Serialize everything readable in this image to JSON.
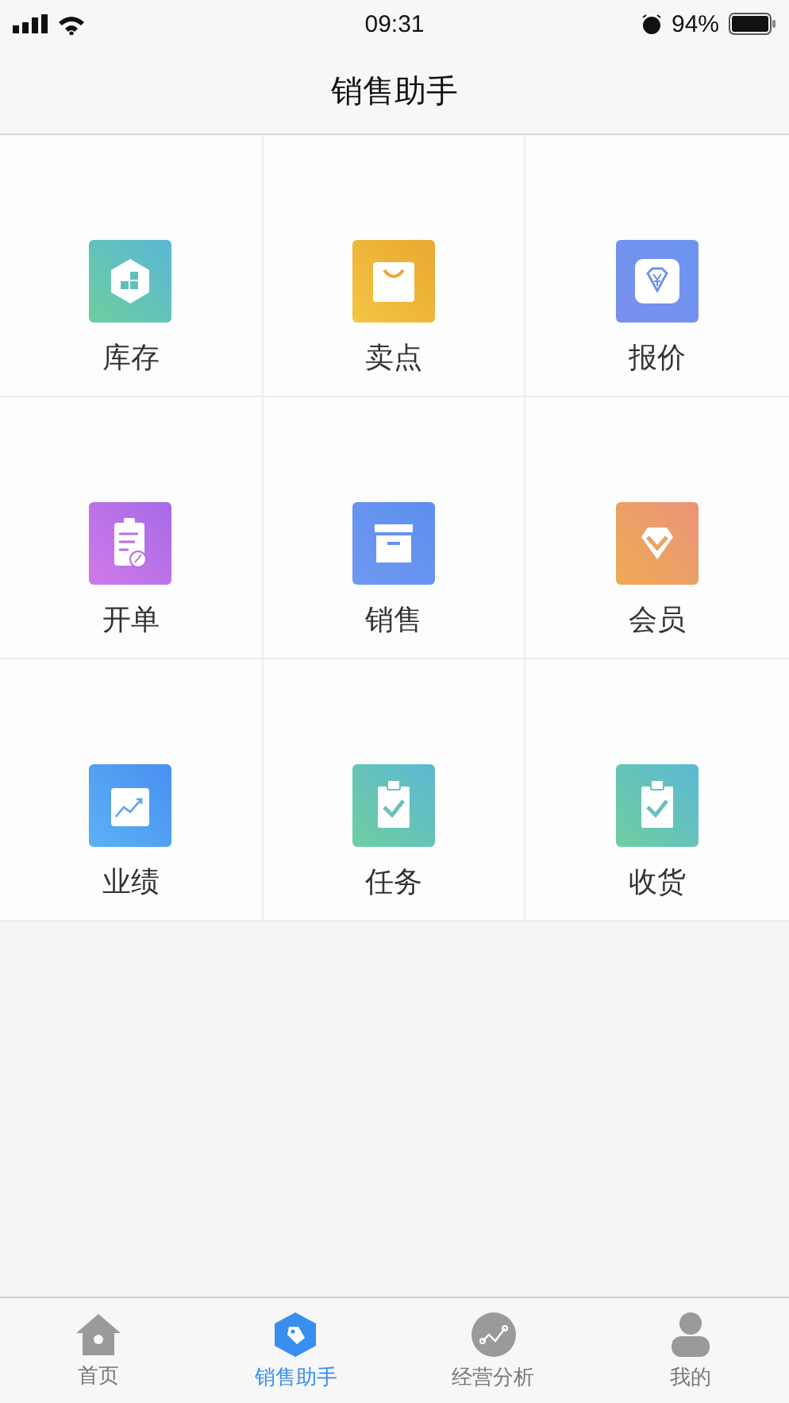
{
  "status_bar": {
    "time": "09:31",
    "battery": "94%"
  },
  "nav_bar": {
    "title": "销售助手"
  },
  "tiles": [
    {
      "label": "库存",
      "kind": "stock"
    },
    {
      "label": "卖点",
      "kind": "bag"
    },
    {
      "label": "报价",
      "kind": "quote"
    },
    {
      "label": "开单",
      "kind": "order"
    },
    {
      "label": "销售",
      "kind": "archive"
    },
    {
      "label": "会员",
      "kind": "member"
    },
    {
      "label": "业绩",
      "kind": "chart"
    },
    {
      "label": "任务",
      "kind": "check"
    },
    {
      "label": "收货",
      "kind": "check"
    }
  ],
  "tab_bar": [
    {
      "label": "首页",
      "kind": "home",
      "selected": false
    },
    {
      "label": "销售助手",
      "kind": "tag",
      "selected": true
    },
    {
      "label": "经营分析",
      "kind": "analysis",
      "selected": false
    },
    {
      "label": "我的",
      "kind": "person",
      "selected": false
    }
  ]
}
